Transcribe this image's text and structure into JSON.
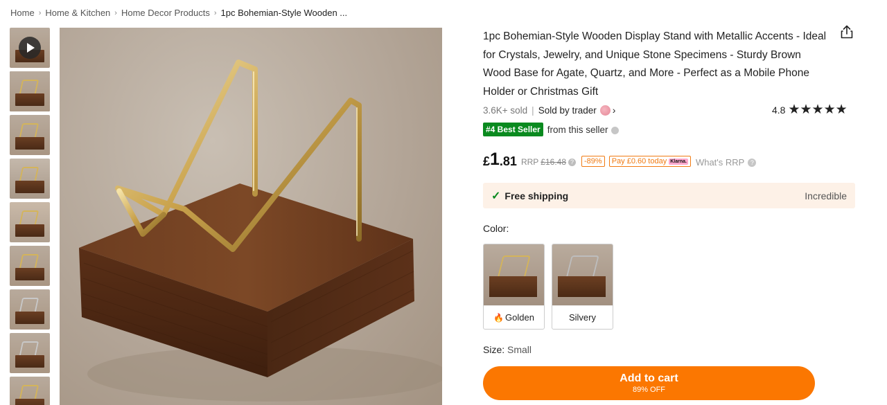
{
  "breadcrumb": {
    "items": [
      "Home",
      "Home & Kitchen",
      "Home Decor Products",
      "1pc Bohemian-Style Wooden ..."
    ]
  },
  "product": {
    "title": "1pc Bohemian-Style Wooden Display Stand with Metallic Accents - Ideal for Crystals, Jewelry, and Unique Stone Specimens - Sturdy Brown Wood Base for Agate, Quartz, and More - Perfect as a Mobile Phone Holder or Christmas Gift",
    "sold": "3.6K+ sold",
    "divider": "|",
    "sold_by": "Sold by trader",
    "rating": "4.8",
    "stars": "★★★★★",
    "best_badge": "#4 Best Seller",
    "best_suffix": "from this seller",
    "price_currency": "£",
    "price_int": "1",
    "price_dec": ".81",
    "rrp_label": "RRP",
    "rrp_value": "£16.48",
    "discount": "-89%",
    "pay_today": "Pay £0.60 today",
    "klarna": "Klarna.",
    "whats_rrp": "What's RRP"
  },
  "shipping": {
    "label": "Free shipping",
    "right": "Incredible"
  },
  "color": {
    "label": "Color:",
    "options": [
      {
        "label": "Golden",
        "selected": true
      },
      {
        "label": "Silvery",
        "selected": false
      }
    ]
  },
  "size": {
    "label": "Size:",
    "value": "Small"
  },
  "cart": {
    "label": "Add to cart",
    "sub": "89% OFF"
  },
  "colors": {
    "accent": "#fb7701",
    "best_badge": "#0a8a1f",
    "shipping_bg": "#fdf1e7",
    "klarna": "#ffa8cd"
  },
  "icons": {
    "share": "share-icon",
    "play": "play-icon",
    "check": "check-icon",
    "flame": "flame-icon",
    "info": "info-icon",
    "chevron": "chevron-right-icon"
  }
}
